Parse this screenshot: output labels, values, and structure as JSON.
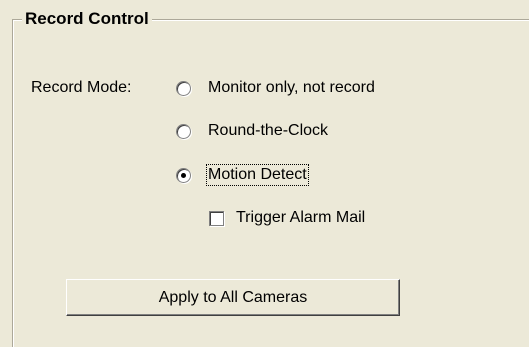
{
  "group": {
    "title": "Record Control"
  },
  "record_mode": {
    "label": "Record Mode:",
    "options": [
      {
        "label": "Monitor only, not record",
        "checked": false
      },
      {
        "label": "Round-the-Clock",
        "checked": false
      },
      {
        "label": "Motion Detect",
        "checked": true
      }
    ]
  },
  "trigger_alarm_mail": {
    "label": "Trigger Alarm Mail",
    "checked": false
  },
  "apply_button": {
    "label": "Apply to All Cameras"
  }
}
